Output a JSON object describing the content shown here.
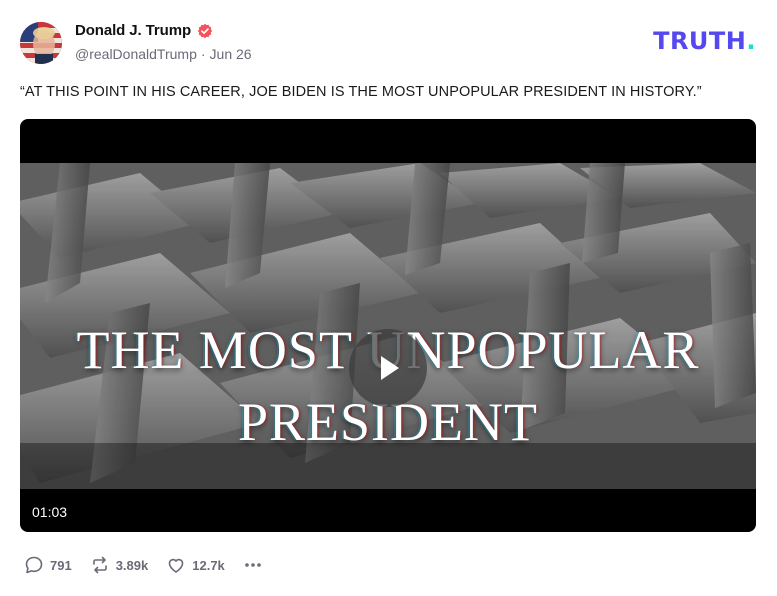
{
  "author": {
    "display_name": "Donald J. Trump",
    "handle": "@realDonaldTrump",
    "separator": "·",
    "date": "Jun 26"
  },
  "brand": {
    "name": "TRUTH",
    "dot": ".",
    "color": "#5448ee",
    "dot_color": "#17e2c7"
  },
  "post": {
    "text": "“AT THIS POINT IN HIS CAREER, JOE BIDEN IS THE MOST UNPOPULAR PRESIDENT IN HISTORY.”"
  },
  "video": {
    "overlay_line1": "THE MOST UNPOPULAR",
    "overlay_line2": "PRESIDENT",
    "duration": "01:03"
  },
  "actions": {
    "replies": "791",
    "retruths": "3.89k",
    "likes": "12.7k"
  },
  "icons": {
    "verified": "verified-badge-icon",
    "play": "play-icon",
    "reply": "speech-bubble-icon",
    "retruth": "repost-arrows-icon",
    "like": "heart-icon",
    "more": "ellipsis-icon"
  },
  "colors": {
    "verified": "#f4525c",
    "muted": "#6b6b78"
  }
}
